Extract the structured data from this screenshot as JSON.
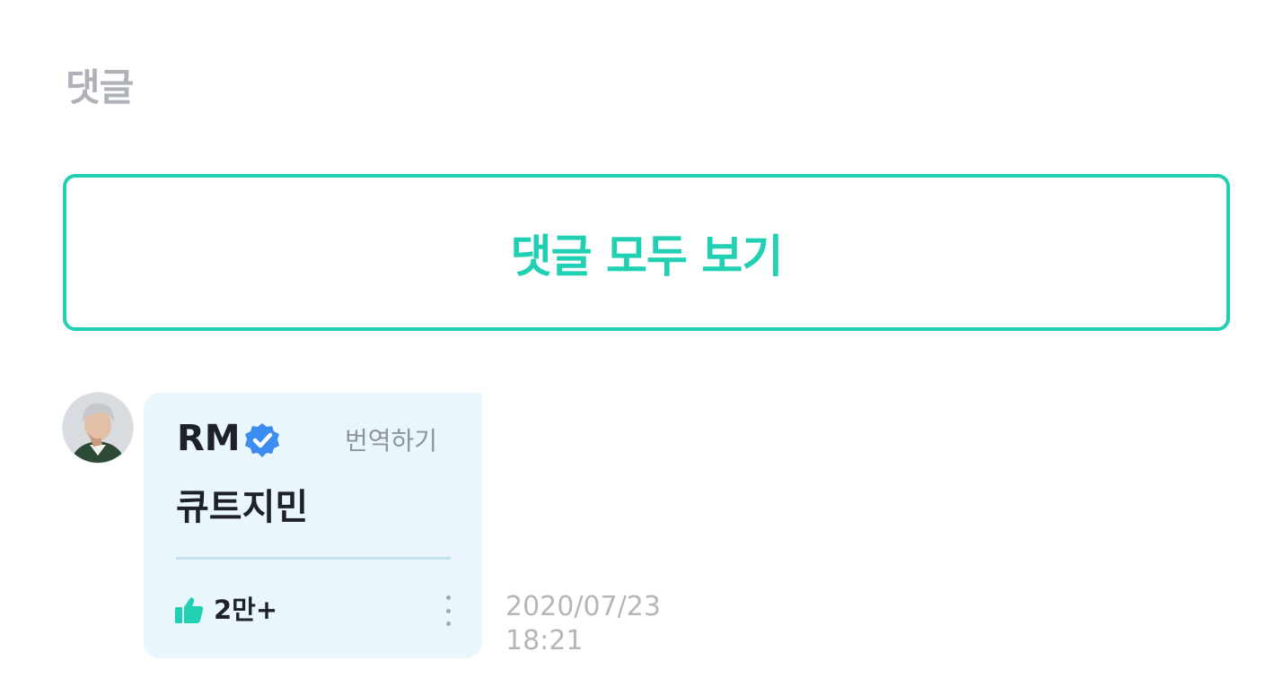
{
  "comments_section": {
    "title": "댓글",
    "view_all_label": "댓글 모두 보기",
    "accent_color": "#21d0b2"
  },
  "comment": {
    "author": "RM",
    "verified_icon": "verified-badge-icon",
    "translate_label": "번역하기",
    "text": "큐트지민",
    "like_icon": "thumbs-up-icon",
    "like_count": "2만+",
    "more_icon": "vertical-ellipsis-icon",
    "date": "2020/07/23",
    "time": "18:21"
  }
}
